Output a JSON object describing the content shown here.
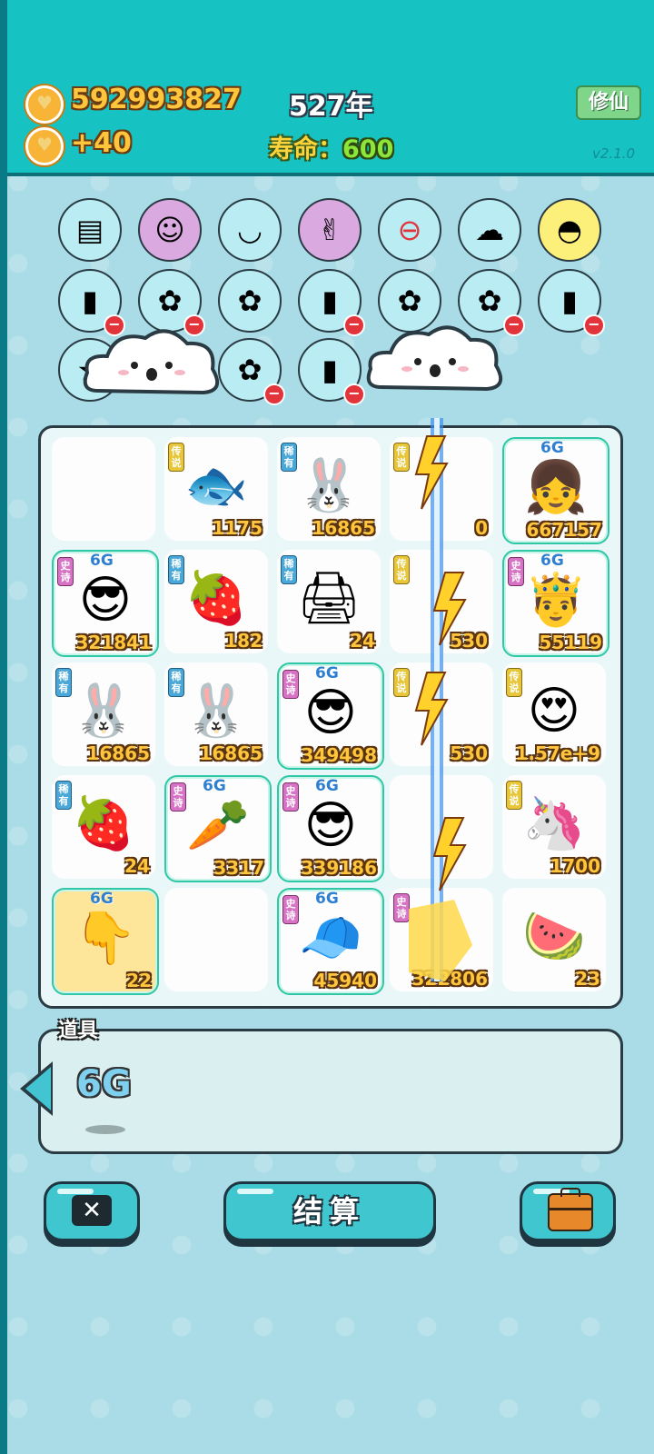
{
  "header": {
    "coins": "592993827",
    "income": "+40",
    "year": "527年",
    "life_label": "寿命：",
    "life_value": "600",
    "xiuxian_button": "修仙",
    "version": "v2.1.0"
  },
  "shelf_icons": [
    "skirt-icon",
    "math-face-icon",
    "rice-bowl-icon",
    "rock-hand-icon",
    "minus-circle-icon",
    "ghost-icon",
    "shell-icon",
    "money-bag-icon",
    "flower-pot-icon",
    "flower-pot-icon",
    "money-bag-icon",
    "flower-pot-icon",
    "flower-pot-icon",
    "money-bag-icon",
    "star-icon",
    "flower-pot-icon",
    "money-bag-icon"
  ],
  "board": {
    "cells": [
      {
        "name": "empty",
        "count": "",
        "tag": "",
        "tag_color": "",
        "sg": ""
      },
      {
        "name": "koi-fish",
        "count": "1175",
        "tag": "传说",
        "tag_color": "yellow",
        "sg": ""
      },
      {
        "name": "rabbit",
        "count": "16865",
        "tag": "稀有",
        "tag_color": "blue",
        "sg": ""
      },
      {
        "name": "unknown",
        "count": "0",
        "tag": "传说",
        "tag_color": "yellow",
        "sg": ""
      },
      {
        "name": "girl",
        "count": "667157",
        "tag": "",
        "tag_color": "",
        "sg": "6G"
      },
      {
        "name": "sunglasses-man",
        "count": "321841",
        "tag": "史诗",
        "tag_color": "pink",
        "sg": "6G"
      },
      {
        "name": "lychee",
        "count": "182",
        "tag": "稀有",
        "tag_color": "blue",
        "sg": ""
      },
      {
        "name": "printer",
        "count": "24",
        "tag": "稀有",
        "tag_color": "blue",
        "sg": ""
      },
      {
        "name": "unknown",
        "count": "530",
        "tag": "传说",
        "tag_color": "yellow",
        "sg": ""
      },
      {
        "name": "king-face",
        "count": "55119",
        "tag": "史诗",
        "tag_color": "pink",
        "sg": "6G"
      },
      {
        "name": "rabbit",
        "count": "16865",
        "tag": "稀有",
        "tag_color": "blue",
        "sg": ""
      },
      {
        "name": "rabbit",
        "count": "16865",
        "tag": "稀有",
        "tag_color": "blue",
        "sg": ""
      },
      {
        "name": "sunglasses-man",
        "count": "349498",
        "tag": "史诗",
        "tag_color": "pink",
        "sg": "6G"
      },
      {
        "name": "unknown",
        "count": "530",
        "tag": "传说",
        "tag_color": "yellow",
        "sg": ""
      },
      {
        "name": "heart-eyes-face",
        "count": "1.57e+9",
        "tag": "传说",
        "tag_color": "yellow",
        "sg": ""
      },
      {
        "name": "lychee",
        "count": "24",
        "tag": "稀有",
        "tag_color": "blue",
        "sg": ""
      },
      {
        "name": "crowned-carrot",
        "count": "3317",
        "tag": "史诗",
        "tag_color": "pink",
        "sg": "6G"
      },
      {
        "name": "sunglasses-man",
        "count": "339186",
        "tag": "史诗",
        "tag_color": "pink",
        "sg": "6G"
      },
      {
        "name": "empty",
        "count": "",
        "tag": "",
        "tag_color": "",
        "sg": ""
      },
      {
        "name": "unicorn",
        "count": "1700",
        "tag": "传说",
        "tag_color": "yellow",
        "sg": ""
      },
      {
        "name": "pointing-hand",
        "count": "22",
        "tag": "",
        "tag_color": "",
        "sg": "6G"
      },
      {
        "name": "empty",
        "count": "",
        "tag": "",
        "tag_color": "",
        "sg": ""
      },
      {
        "name": "red-cap-boy",
        "count": "45940",
        "tag": "史诗",
        "tag_color": "pink",
        "sg": "6G"
      },
      {
        "name": "unknown",
        "count": "322806",
        "tag": "史诗",
        "tag_color": "pink",
        "sg": ""
      },
      {
        "name": "watermelon",
        "count": "23",
        "tag": "",
        "tag_color": "",
        "sg": ""
      }
    ]
  },
  "tools": {
    "title": "道具",
    "item": "6G"
  },
  "buttons": {
    "settle": "结算"
  },
  "colors": {
    "header_bg": "#17c2c3",
    "coin_text": "#ffc53d",
    "life_value": "#8ee53a",
    "button": "#3fc6cf"
  }
}
